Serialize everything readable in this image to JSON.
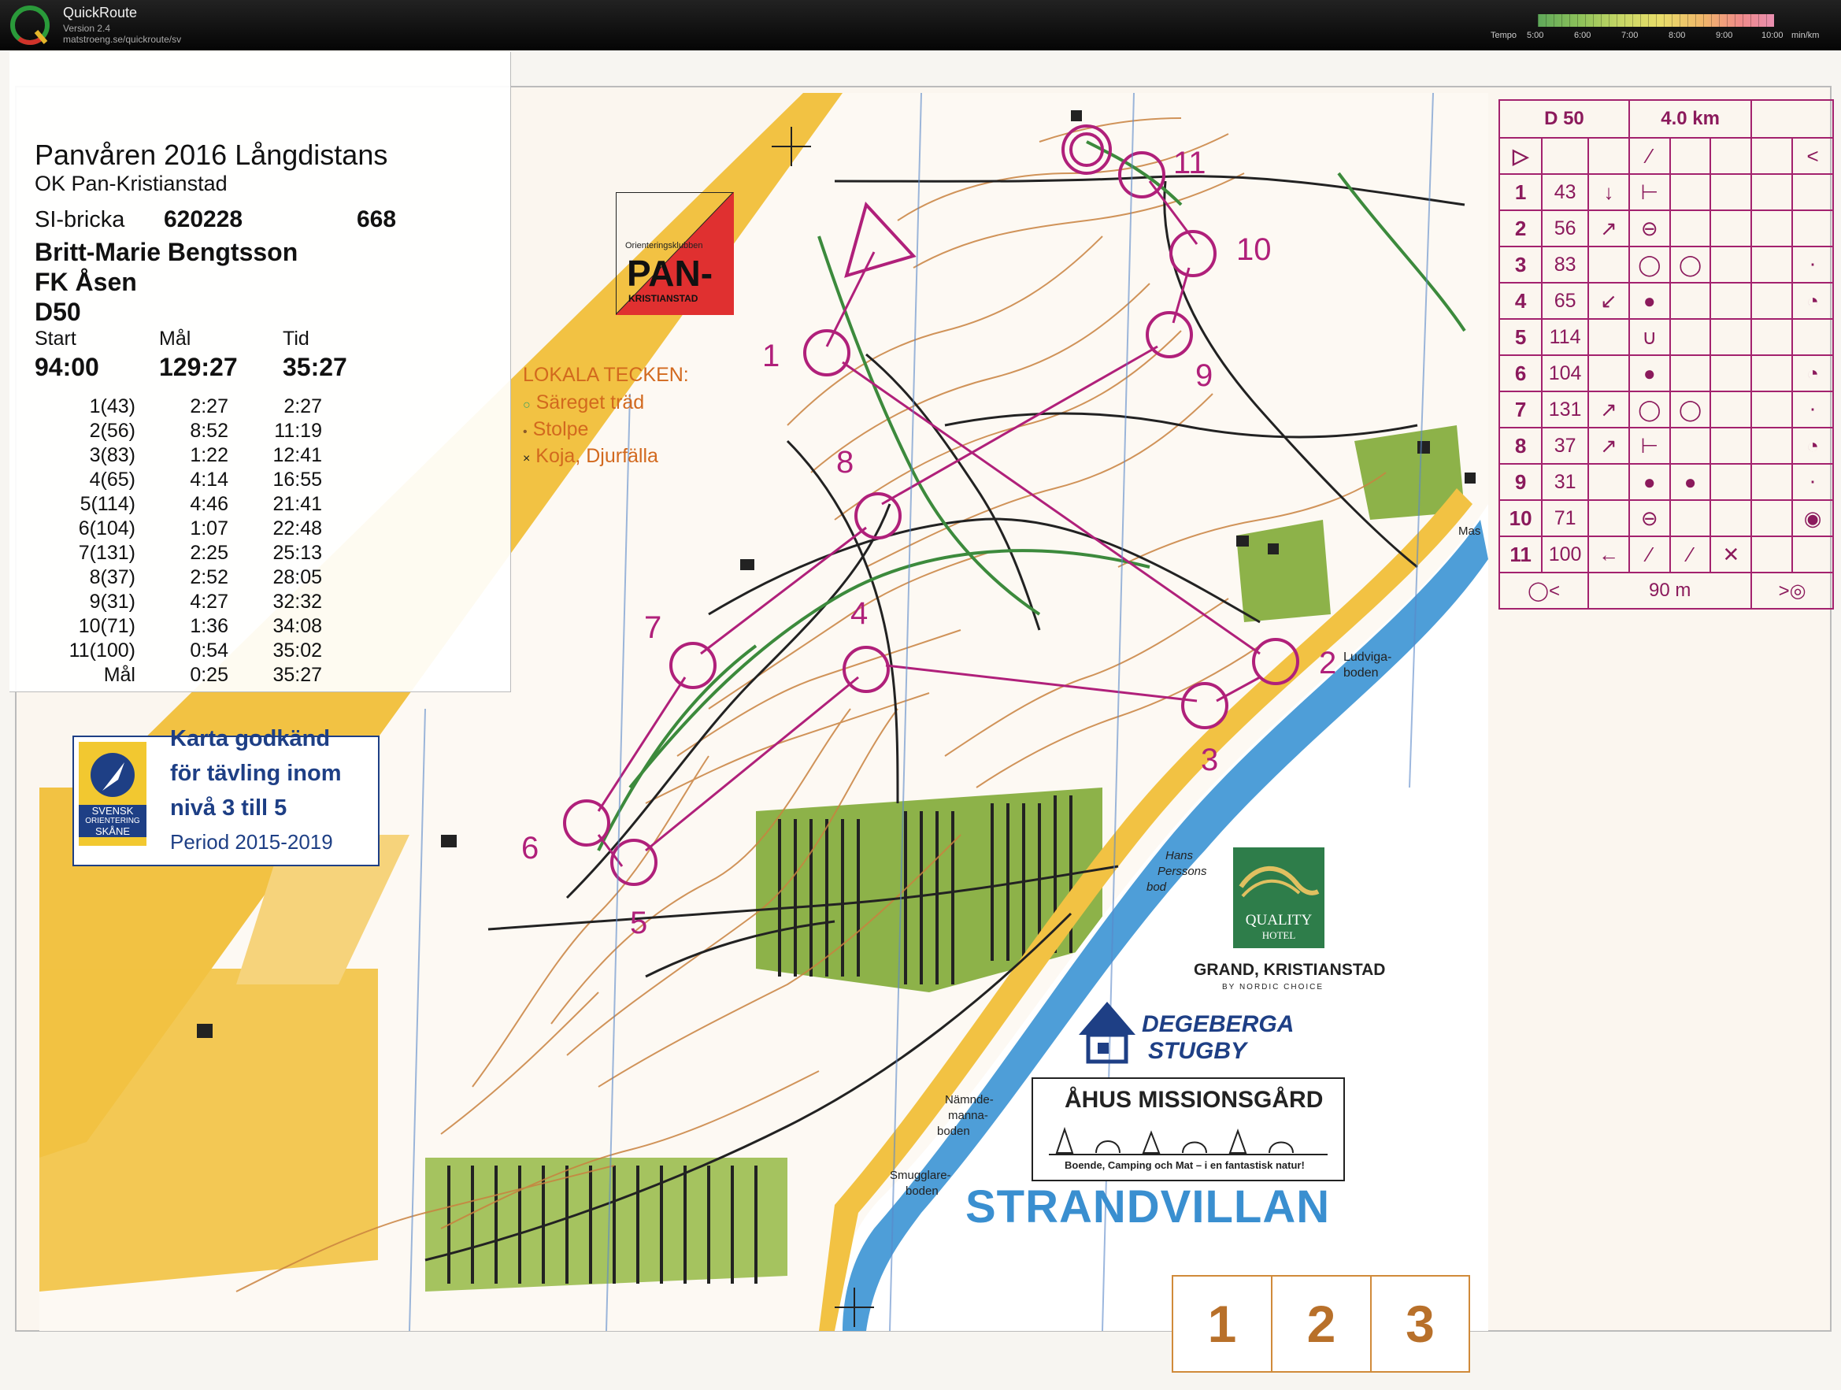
{
  "window": {
    "app_name": "QuickRoute",
    "version": "Version 2.4",
    "url": "matstroeng.se/quickroute/sv",
    "tempo_label": "Tempo",
    "tempo_ticks": [
      "5:00",
      "6:00",
      "7:00",
      "8:00",
      "9:00",
      "10:00"
    ],
    "tempo_unit": "min/km"
  },
  "info": {
    "event": "Panvåren 2016 Långdistans",
    "organizer": "OK Pan-Kristianstad",
    "si_label": "SI-bricka",
    "si_card": "620228",
    "bib": "668",
    "runner": "Britt-Marie Bengtsson",
    "club": "FK Åsen",
    "class": "D50",
    "start_label": "Start",
    "finish_label": "Mål",
    "time_label": "Tid",
    "start": "94:00",
    "finish": "129:27",
    "time": "35:27",
    "splits": [
      {
        "control": "1(43)",
        "leg": "2:27",
        "total": "2:27"
      },
      {
        "control": "2(56)",
        "leg": "8:52",
        "total": "11:19"
      },
      {
        "control": "3(83)",
        "leg": "1:22",
        "total": "12:41"
      },
      {
        "control": "4(65)",
        "leg": "4:14",
        "total": "16:55"
      },
      {
        "control": "5(114)",
        "leg": "4:46",
        "total": "21:41"
      },
      {
        "control": "6(104)",
        "leg": "1:07",
        "total": "22:48"
      },
      {
        "control": "7(131)",
        "leg": "2:25",
        "total": "25:13"
      },
      {
        "control": "8(37)",
        "leg": "2:52",
        "total": "28:05"
      },
      {
        "control": "9(31)",
        "leg": "4:27",
        "total": "32:32"
      },
      {
        "control": "10(71)",
        "leg": "1:36",
        "total": "34:08"
      },
      {
        "control": "11(100)",
        "leg": "0:54",
        "total": "35:02"
      },
      {
        "control": "Mål",
        "leg": "0:25",
        "total": "35:27"
      }
    ]
  },
  "map": {
    "club_badge_top": "Orienteringsklubben",
    "club_badge_main": "PAN-",
    "club_badge_sub": "KRISTIANSTAD",
    "legend_title": "LOKALA TECKEN:",
    "legend_items": [
      "Säreget träd",
      "Stolpe",
      "Koja, Djurfälla"
    ],
    "approval_lines": [
      "Karta godkänd",
      "för tävling inom",
      "nivå 3 till 5"
    ],
    "approval_period": "Period 2015-2019",
    "sof_text_1": "SVENSK",
    "sof_text_2": "ORIENTERING",
    "sof_text_3": "SKÅNE",
    "sponsor_quality": "QUALITY",
    "sponsor_quality_sub": "HOTEL",
    "sponsor_grand": "GRAND, KRISTIANSTAD",
    "sponsor_nordic": "BY NORDIC CHOICE",
    "sponsor_degeberga_1": "DEGEBERGA",
    "sponsor_degeberga_2": "STUGBY",
    "sponsor_ahus": "ÅHUS MISSIONSGÅRD",
    "sponsor_ahus_sub": "Boende, Camping och Mat – i en fantastisk natur!",
    "sponsor_strand": "STRANDVILLAN",
    "place_ludviga": "Ludviga-",
    "place_boden": "boden",
    "place_hans_1": "Hans",
    "place_hans_2": "Perssons",
    "place_hans_3": "bod",
    "place_namnde_1": "Nämnde-",
    "place_namnde_2": "manna-",
    "place_namnde_3": "boden",
    "place_smug_1": "Smugglare-",
    "place_smug_2": "boden",
    "place_mas": "Mas",
    "page_numbers": [
      "1",
      "2",
      "3"
    ],
    "control_labels": [
      "1",
      "2",
      "3",
      "4",
      "5",
      "6",
      "7",
      "8",
      "9",
      "10",
      "11"
    ]
  },
  "description_sheet": {
    "class": "D 50",
    "length": "4.0 km",
    "rows": [
      {
        "num": "1",
        "code": "43"
      },
      {
        "num": "2",
        "code": "56"
      },
      {
        "num": "3",
        "code": "83"
      },
      {
        "num": "4",
        "code": "65"
      },
      {
        "num": "5",
        "code": "114"
      },
      {
        "num": "6",
        "code": "104"
      },
      {
        "num": "7",
        "code": "131"
      },
      {
        "num": "8",
        "code": "37"
      },
      {
        "num": "9",
        "code": "31"
      },
      {
        "num": "10",
        "code": "71"
      },
      {
        "num": "11",
        "code": "100"
      }
    ],
    "finish_distance": "90 m"
  },
  "colors": {
    "course": "#b0207a",
    "map_yellow": "#f2c243",
    "map_green": "#8db249",
    "sea_blue": "#4e9ed8",
    "contour_brown": "#c9823f"
  }
}
